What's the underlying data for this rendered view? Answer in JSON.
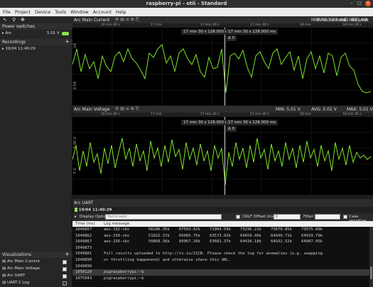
{
  "window": {
    "title": "raspberry-pi - otii - Standard"
  },
  "menu": [
    "File",
    "Project",
    "Device",
    "Tools",
    "Window",
    "Account",
    "Help"
  ],
  "sidebar": {
    "power_switches_label": "Power switches",
    "arc_label": "Arc",
    "arc_voltage": "5.01 V",
    "recordings_label": "Recordings",
    "recording_item": "19/04 11:40:29",
    "visualizations_label": "Visualizations",
    "visualizations": [
      {
        "label": "Arc Main Current",
        "checked": true
      },
      {
        "label": "Arc Main Voltage",
        "checked": true
      },
      {
        "label": "Arc UART",
        "checked": true
      },
      {
        "label": "UART-1 Log",
        "checked": false
      }
    ]
  },
  "current_panel": {
    "title": "Arc Main Current",
    "stats": {
      "min": "MIN: 693 mA",
      "avg": "AVG: 693 mA",
      "max": "MAX: 693 mA",
      "energy": "E: 965 µWh"
    },
    "ruler": [
      "16 min 40 s",
      "17 min",
      "17 min 20 s",
      "17 min 40 s",
      "18 min",
      "18 min 20 s"
    ],
    "cursor_time": "17 min 30 s 128.000 ms",
    "cursor_time2": "17 min 30 s 128.000 ms",
    "delta": "Δ 0",
    "y_labels": [
      "1A",
      "0.5A"
    ]
  },
  "voltage_panel": {
    "title": "Arc Main Voltage",
    "stats": {
      "min": "MIN: 5.01 V",
      "avg": "AVG: 5.01 V",
      "max": "MAX: 5.01 V"
    },
    "ruler": [
      "16 min 40 s",
      "17 min",
      "17 min 20 s",
      "17 min 40 s",
      "18 min",
      "18 min 20 s"
    ],
    "cursor_time": "17 min 30 s 128.000 ms",
    "cursor_time2": "17 min 30 s 128.000 ms",
    "delta": "Δ 0",
    "y_labels": [
      "5.05 V",
      "5 V"
    ]
  },
  "uart_panel": {
    "title": "Arc UART",
    "recording": "19/04 11:40:29",
    "display_options": "Display Options",
    "send_placeholder": "Text to send...",
    "crlf": "CRLF",
    "offset_label": "Offset (ms):",
    "offset_value": "0",
    "filter_label": "Filter:",
    "case_label": "Case sensitive",
    "columns": [
      "Time (ms)",
      "Log message"
    ],
    "rows": [
      {
        "time": "1049857",
        "msg": "aes-192-cbc        56286.35k    67503.62k    71964.59k    73296.21k    73678.85k    73575.08k",
        "hl": false
      },
      {
        "time": "1049862",
        "msg": "aes-256-cbc        51022.37k    60066.75k    63573.93k    64659.46k    64940.71k    64929.79k",
        "hl": false
      },
      {
        "time": "1049867",
        "msg": "aes-256-cbc        50868.36k    60067.20k    63681.37k    64434.18k    64932.52k    64907.95k",
        "hl": false
      },
      {
        "time": "1049873",
        "msg": "",
        "hl": false
      },
      {
        "time": "1049881",
        "msg": "Full results uploaded to http://ix.io/21CB. Please check the log for anomalies (e.g. swapping",
        "hl": false
      },
      {
        "time": "1049890",
        "msg": "or throttling happenend) and otherwise share this URL.",
        "hl": false
      },
      {
        "time": "1049890",
        "msg": "",
        "hl": false
      },
      {
        "time": "1050120",
        "msg": "pi@raspberrypi:~$",
        "hl": true
      },
      {
        "time": "1075943",
        "msg": "pi@raspberrypi:~$",
        "hl": false
      }
    ]
  },
  "colors": {
    "trace": "#7fe32a",
    "accent": "#8de04a"
  }
}
